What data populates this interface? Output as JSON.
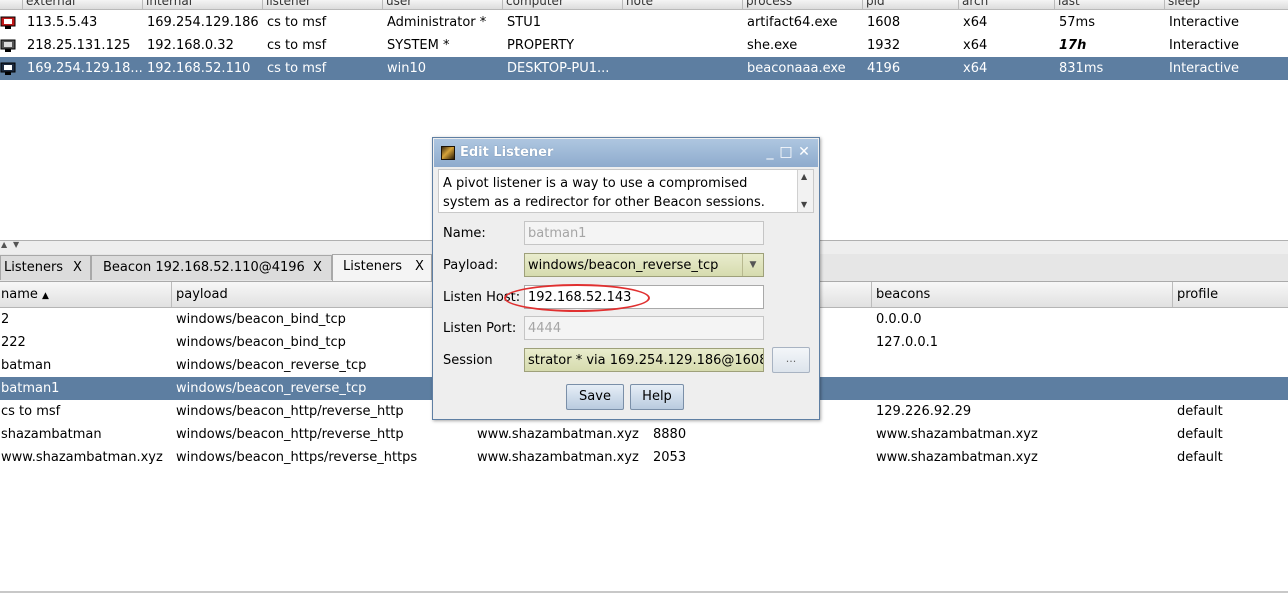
{
  "sessions": {
    "columns": [
      "external",
      "internal",
      "listener",
      "user",
      "computer",
      "note",
      "process",
      "pid",
      "arch",
      "last",
      "sleep"
    ],
    "rows": [
      {
        "external": "113.5.5.43",
        "internal": "169.254.129.186",
        "listener": "cs to msf",
        "user": "Administrator *",
        "computer": "STU1",
        "note": "",
        "process": "artifact64.exe",
        "pid": "1608",
        "arch": "x64",
        "last": "57ms",
        "sleep": "Interactive"
      },
      {
        "external": "218.25.131.125",
        "internal": "192.168.0.32",
        "listener": "cs to msf",
        "user": "SYSTEM *",
        "computer": "PROPERTY",
        "note": "",
        "process": "she.exe",
        "pid": "1932",
        "arch": "x64",
        "last": "17h",
        "sleep": "Interactive"
      },
      {
        "external": "169.254.129.18...",
        "internal": "192.168.52.110",
        "listener": "cs to msf",
        "user": "win10",
        "computer": "DESKTOP-PU1...",
        "note": "",
        "process": "beaconaaa.exe",
        "pid": "4196",
        "arch": "x64",
        "last": "831ms",
        "sleep": "Interactive"
      }
    ]
  },
  "tabs": [
    {
      "label": "Listeners",
      "close": "X"
    },
    {
      "label": "Beacon 192.168.52.110@4196",
      "close": "X"
    },
    {
      "label": "Listeners",
      "close": "X"
    }
  ],
  "listeners": {
    "columns": {
      "name": "name",
      "payload": "payload",
      "beacons": "beacons",
      "profile": "profile"
    },
    "rows": [
      {
        "name": "2",
        "payload": "windows/beacon_bind_tcp",
        "host": "",
        "port": "",
        "beacons": "0.0.0.0",
        "profile": ""
      },
      {
        "name": "222",
        "payload": "windows/beacon_bind_tcp",
        "host": "",
        "port": "",
        "beacons": "127.0.0.1",
        "profile": ""
      },
      {
        "name": "batman",
        "payload": "windows/beacon_reverse_tcp",
        "host": "",
        "port": "",
        "beacons": "",
        "profile": ""
      },
      {
        "name": "batman1",
        "payload": "windows/beacon_reverse_tcp",
        "host": "",
        "port": "",
        "beacons": "",
        "profile": ""
      },
      {
        "name": "cs to msf",
        "payload": "windows/beacon_http/reverse_http",
        "host": "",
        "port": "",
        "beacons": "129.226.92.29",
        "profile": "default"
      },
      {
        "name": "shazambatman",
        "payload": "windows/beacon_http/reverse_http",
        "host": "www.shazambatman.xyz",
        "port": "8880",
        "beacons": "www.shazambatman.xyz",
        "profile": "default"
      },
      {
        "name": "www.shazambatman.xyz",
        "payload": "windows/beacon_https/reverse_https",
        "host": "www.shazambatman.xyz",
        "port": "2053",
        "beacons": "www.shazambatman.xyz",
        "profile": "default"
      }
    ]
  },
  "dialog": {
    "title": "Edit Listener",
    "description": "A pivot listener is a way to use a compromised system as a redirector for other Beacon sessions.",
    "name_label": "Name:",
    "name_value": "batman1",
    "payload_label": "Payload:",
    "payload_value": "windows/beacon_reverse_tcp",
    "host_label": "Listen Host:",
    "host_value": "192.168.52.143",
    "port_label": "Listen Port:",
    "port_value": "4444",
    "session_label": "Session",
    "session_value": "strator * via  169.254.129.186@1608",
    "browse_label": "...",
    "save_label": "Save",
    "help_label": "Help",
    "window_buttons": {
      "minimize": "_",
      "maximize": "□",
      "close": "✕"
    }
  },
  "colors": {
    "selection": "#5d7ea1",
    "titlebar": "#9db8d8",
    "highlight_circle": "#e03030"
  },
  "icons": [
    "computer-icon",
    "sort-ascending-icon",
    "dropdown-arrow-icon",
    "app-icon",
    "scroll-up-icon",
    "scroll-down-icon"
  ]
}
